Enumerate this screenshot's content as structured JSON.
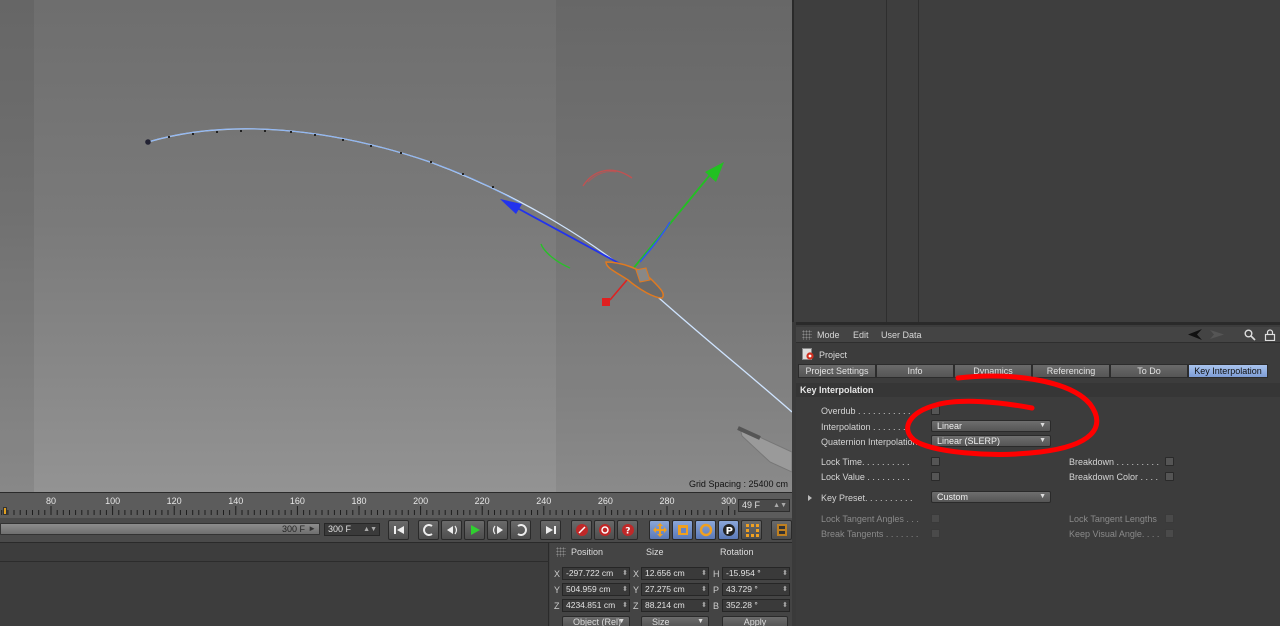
{
  "viewport": {
    "grid_spacing": "Grid Spacing : 25400 cm"
  },
  "timeline": {
    "ticks": [
      "80",
      "100",
      "120",
      "140",
      "160",
      "180",
      "200",
      "220",
      "240",
      "260",
      "280",
      "300"
    ],
    "current_frame": "49 F"
  },
  "transport": {
    "range_end": "300 F",
    "end_field": "300 F",
    "icons": [
      "go-to-start-icon",
      "prev-key-icon",
      "step-back-icon",
      "play-icon",
      "step-forward-icon",
      "next-key-icon",
      "go-to-end-icon",
      "record-icon",
      "autokey-icon",
      "keyframe-selection-icon",
      "move-icon",
      "scale-icon",
      "rotate-icon",
      "parameter-icon",
      "point-level-icon",
      "timeline-icon"
    ]
  },
  "coords": {
    "headers": {
      "position": "Position",
      "size": "Size",
      "rotation": "Rotation"
    },
    "rows": [
      {
        "axis": "X",
        "pos": "-297.722 cm",
        "size_axis": "X",
        "size": "12.656 cm",
        "rot_axis": "H",
        "rot": "-15.954 °"
      },
      {
        "axis": "Y",
        "pos": "504.959 cm",
        "size_axis": "Y",
        "size": "27.275 cm",
        "rot_axis": "P",
        "rot": "43.729 °"
      },
      {
        "axis": "Z",
        "pos": "4234.851 cm",
        "size_axis": "Z",
        "size": "88.214 cm",
        "rot_axis": "B",
        "rot": "352.28 °"
      }
    ],
    "mode_dropdown": "Object (Rel)",
    "size_dropdown": "Size",
    "apply": "Apply"
  },
  "attr": {
    "menu": {
      "mode": "Mode",
      "edit": "Edit",
      "user_data": "User Data"
    },
    "object_name": "Project",
    "tabs": [
      {
        "label": "Project Settings",
        "active": false
      },
      {
        "label": "Info",
        "active": false
      },
      {
        "label": "Dynamics",
        "active": false
      },
      {
        "label": "Referencing",
        "active": false
      },
      {
        "label": "To Do",
        "active": false
      },
      {
        "label": "Key Interpolation",
        "active": true
      }
    ],
    "section_title": "Key Interpolation",
    "props": {
      "overdub": "Overdub . . . . . . . . . . .",
      "interpolation": "Interpolation . . . . . . .",
      "interpolation_value": "Linear",
      "quaternion": "Quaternion Interpolation",
      "quaternion_value": "Linear (SLERP)",
      "lock_time": "Lock Time. . . . . . . . . .",
      "lock_value": "Lock Value . . . . . . . . .",
      "breakdown": "Breakdown . . . . . . . . .",
      "breakdown_color": "Breakdown Color . . . .",
      "key_preset": "Key Preset. . . . . . . . . .",
      "key_preset_value": "Custom",
      "lock_tangent_angles": "Lock Tangent Angles . . .",
      "break_tangents": "Break Tangents . . . . . . .",
      "lock_tangent_lengths": "Lock Tangent Lengths",
      "keep_visual_angle": "Keep Visual Angle. . . ."
    }
  },
  "colors": {
    "x_axis": "#e02020",
    "y_axis": "#22c022",
    "z_axis": "#2233ee",
    "path": "#cfe4ff",
    "annotation": "#ff0000",
    "active_tab": "#8eabe0"
  }
}
